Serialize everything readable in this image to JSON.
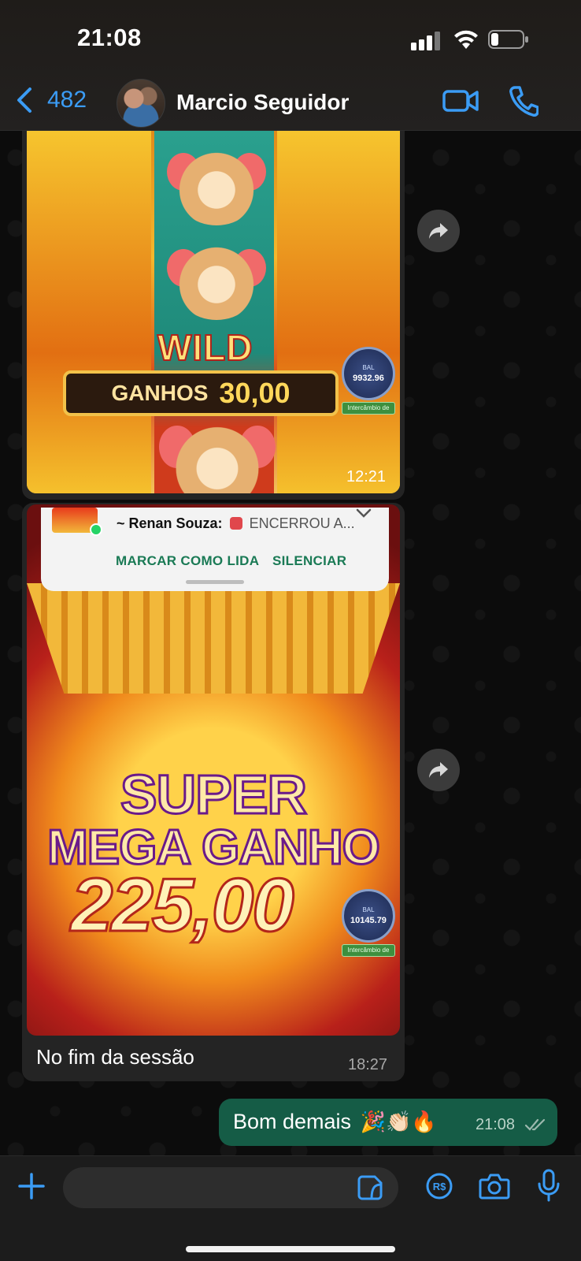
{
  "status_bar": {
    "time": "21:08"
  },
  "header": {
    "back_count": "482",
    "contact_name": "Marcio Seguidor"
  },
  "messages": {
    "first_image": {
      "wild_label": "WILD",
      "win_label": "GANHOS",
      "win_value": "30,00",
      "bal_label": "BAL",
      "bal_value": "9932.96",
      "exchange_label": "Intercâmbio de",
      "time": "12:21"
    },
    "notification": {
      "sender": "~ Renan Souza:",
      "preview": "ENCERROU A...",
      "action_mark_read": "MARCAR COMO LIDA",
      "action_mute": "SILENCIAR"
    },
    "second_image": {
      "title_line1": "SUPER",
      "title_line2": "MEGA GANHO",
      "amount": "225,00",
      "bal_label": "BAL",
      "bal_value": "10145.79",
      "exchange_label": "Intercâmbio de"
    },
    "caption": "No fim da sessão",
    "caption_time": "18:27",
    "outgoing": {
      "text": "Bom demais",
      "emojis": "🎉👏🏻🔥",
      "time": "21:08"
    }
  },
  "composer": {
    "placeholder": ""
  },
  "icons": {
    "accent": "#3b9cf5",
    "outgoing_bubble": "#155c46",
    "incoming_bubble": "#242424"
  }
}
